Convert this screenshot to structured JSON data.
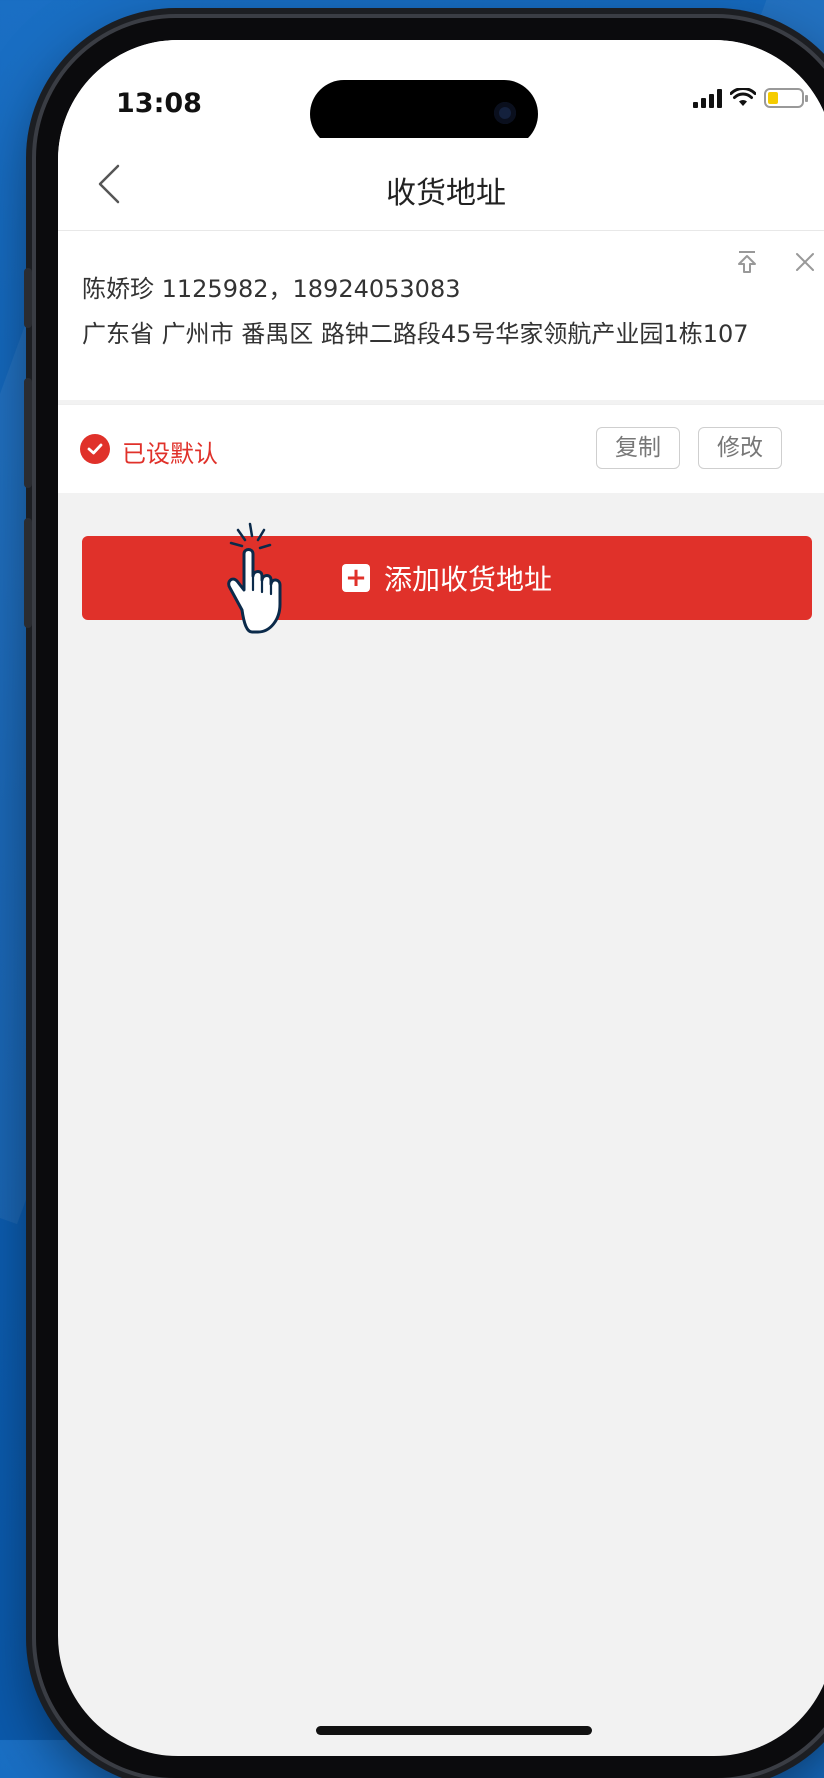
{
  "status_bar": {
    "time": "13:08",
    "battery_color": "#f5cc00"
  },
  "nav": {
    "title": "收货地址",
    "back_icon": "chevron-left-icon"
  },
  "address": {
    "contact": "陈娇珍 1125982，18924053083",
    "full_address": "广东省 广州市 番禺区 路钟二路段45号华家领航产业园1栋107",
    "top_icon": "pin-top-icon",
    "close_icon": "close-icon"
  },
  "default_row": {
    "default_label": "已设默认",
    "copy_label": "复制",
    "edit_label": "修改"
  },
  "add_button": {
    "label": "添加收货地址",
    "icon": "plus-icon"
  },
  "colors": {
    "accent": "#e0312a",
    "background": "#f2f2f2",
    "frame_bg": "#0d5fb3"
  }
}
